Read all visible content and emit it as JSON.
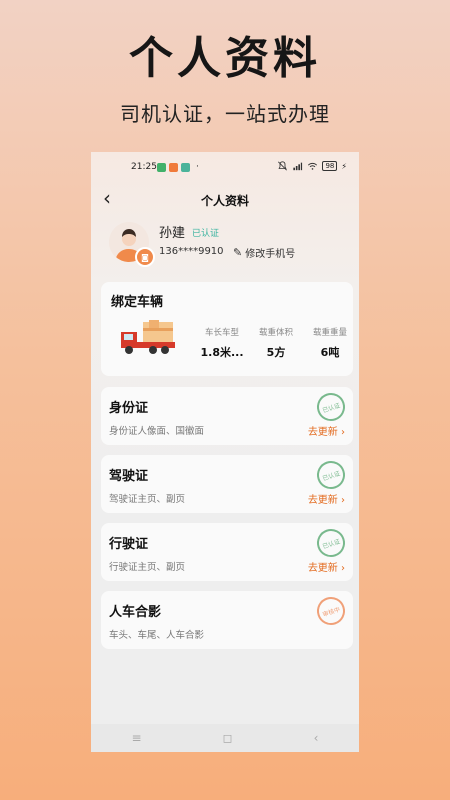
{
  "promo": {
    "title": "个人资料",
    "subtitle": "司机认证，一站式办理"
  },
  "status_bar": {
    "time": "21:25",
    "battery": "98"
  },
  "nav": {
    "title": "个人资料"
  },
  "profile": {
    "name": "孙建",
    "verified_badge": "已认证",
    "phone": "136****9910",
    "edit_phone_label": "修改手机号"
  },
  "vehicle": {
    "title": "绑定车辆",
    "specs": [
      {
        "label": "车长车型",
        "value": "1.8米..."
      },
      {
        "label": "载重体积",
        "value": "5方"
      },
      {
        "label": "载重重量",
        "value": "6吨"
      }
    ]
  },
  "cards": [
    {
      "title": "身份证",
      "desc": "身份证人像面、国徽面",
      "action": "去更新 ›",
      "stamp": "已认证"
    },
    {
      "title": "驾驶证",
      "desc": "驾驶证主页、副页",
      "action": "去更新 ›",
      "stamp": "已认证"
    },
    {
      "title": "行驶证",
      "desc": "行驶证主页、副页",
      "action": "去更新 ›",
      "stamp": "已认证"
    },
    {
      "title": "人车合影",
      "desc": "车头、车尾、人车合影",
      "action": "",
      "stamp": "审核中"
    }
  ],
  "bottom_nav": {
    "menu": "≡",
    "home": "◻",
    "back": "‹"
  },
  "colors": {
    "accent": "#e36a1e",
    "verified": "#39b39f",
    "stamp_green": "#79b98d",
    "stamp_orange": "#f0a078"
  }
}
